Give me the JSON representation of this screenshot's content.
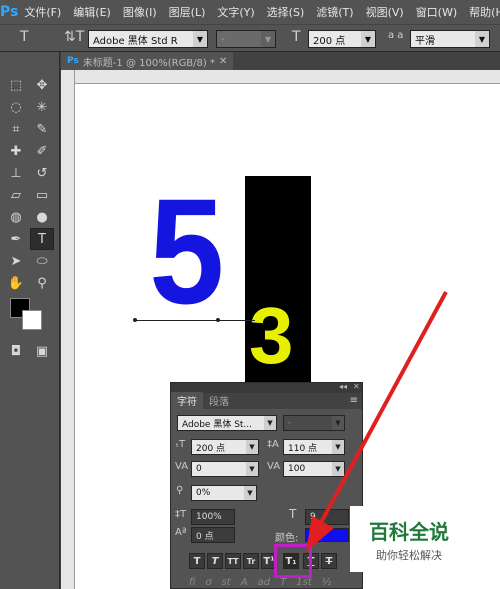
{
  "app": {
    "logo": "Ps"
  },
  "menu": [
    "文件(F)",
    "编辑(E)",
    "图像(I)",
    "图层(L)",
    "文字(Y)",
    "选择(S)",
    "滤镜(T)",
    "视图(V)",
    "窗口(W)",
    "帮助(H)"
  ],
  "options_bar": {
    "font_family": "Adobe 黑体 Std R",
    "font_style": "-",
    "font_size": "200 点",
    "aa_label": "a a",
    "antialias": "平滑"
  },
  "document_tab": {
    "title": "未标题-1 @ 100%(RGB/8) *"
  },
  "canvas": {
    "digit_a": "5",
    "digit_b": "3"
  },
  "character_panel": {
    "tab_character": "字符",
    "tab_paragraph": "段落",
    "font_family": "Adobe 黑体 St...",
    "font_style": "-",
    "font_size": "200 点",
    "leading": "110 点",
    "kerning": "0",
    "tracking": "100",
    "tsume": "0%",
    "vertical_scale": "100%",
    "horizontal_scale": "9",
    "baseline_shift": "0 点",
    "color_label": "颜色:",
    "style_buttons": [
      "T",
      "T",
      "TT",
      "Tr",
      "T¹",
      "T₁",
      "T",
      "T"
    ],
    "bottom_row": [
      "fi",
      "ơ",
      "st",
      "A",
      "ad",
      "T",
      "1st",
      "½"
    ]
  },
  "colors": {
    "text_five": "#1515e0",
    "text_three": "#e8f000",
    "bar": "#000000",
    "highlight": "#c01ec8",
    "arrow": "#e02020"
  },
  "watermark": {
    "main": "百科全说",
    "sub": "助你轻松解决"
  }
}
